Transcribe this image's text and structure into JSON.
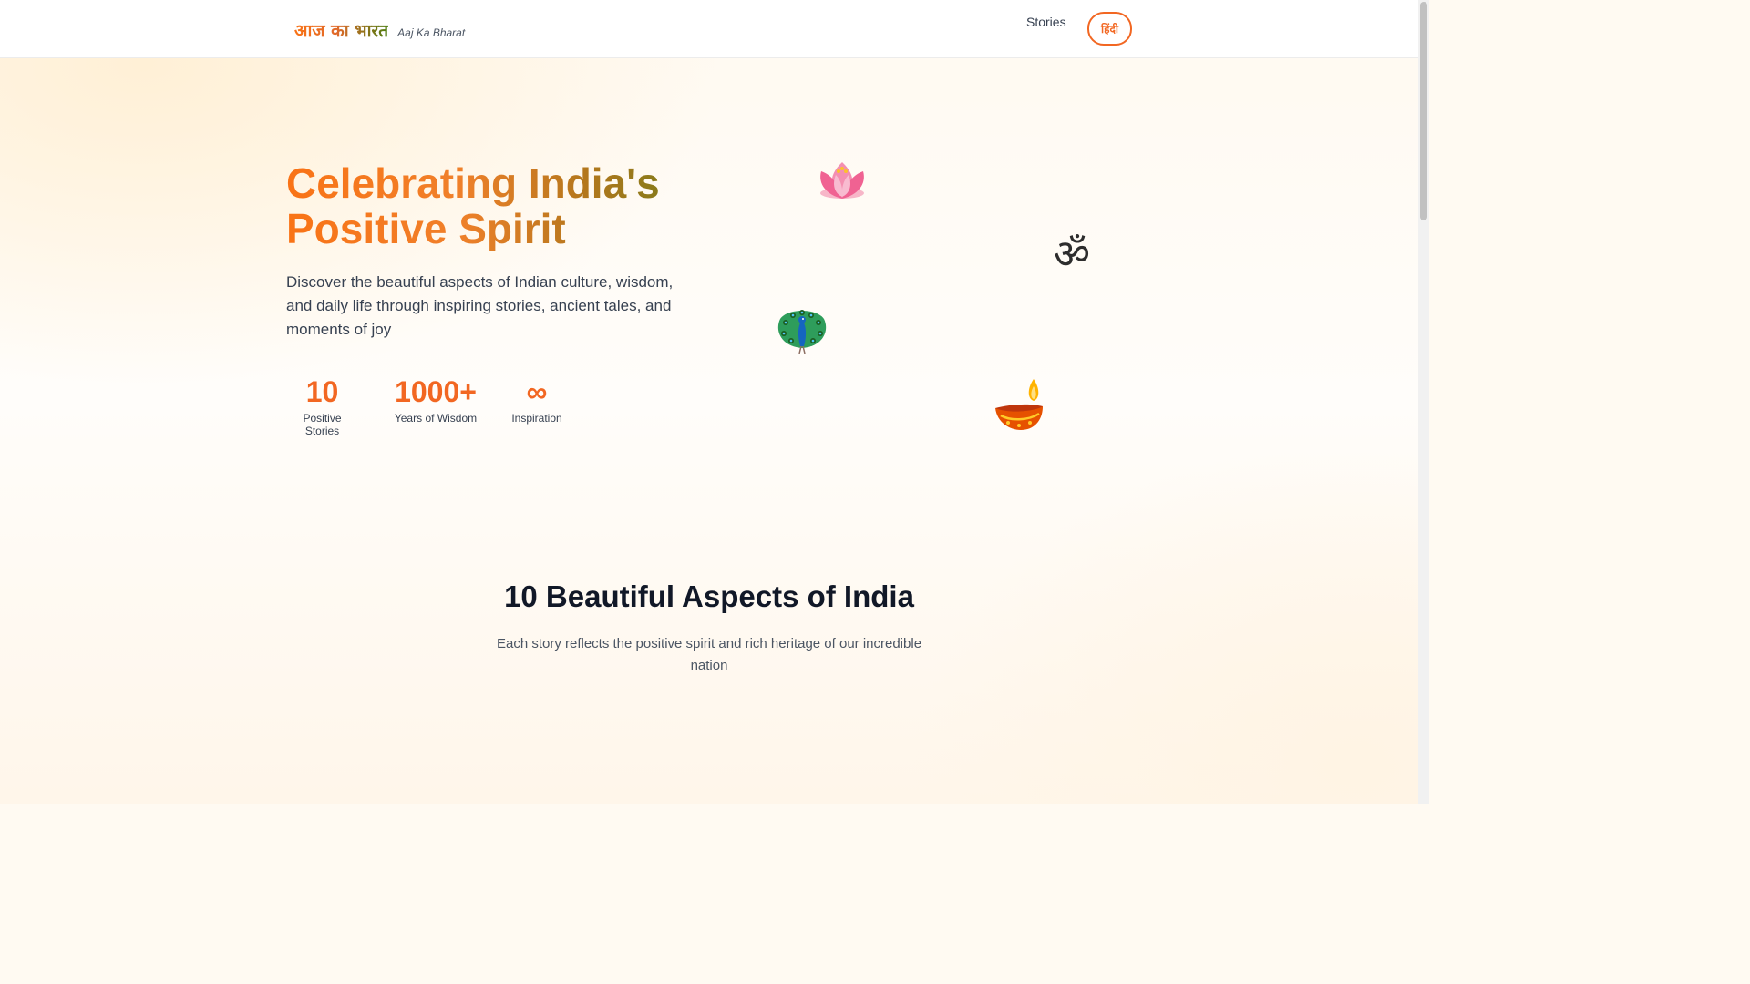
{
  "header": {
    "logo_hindi": "आज का भारत",
    "logo_sub": "Aaj Ka Bharat",
    "nav_stories": "Stories",
    "lang_toggle": "हिंदी"
  },
  "hero": {
    "title": "Celebrating India's Positive Spirit",
    "description": "Discover the beautiful aspects of Indian culture, wisdom, and daily life through inspiring stories, ancient tales, and moments of joy",
    "stats": [
      {
        "value": "10",
        "label": "Positive Stories"
      },
      {
        "value": "1000+",
        "label": "Years of Wisdom"
      },
      {
        "value": "∞",
        "label": "Inspiration"
      }
    ],
    "decor_icons": [
      "lotus-icon",
      "om-icon",
      "peacock-icon",
      "diya-icon"
    ]
  },
  "section": {
    "title": "10 Beautiful Aspects of India",
    "subtitle": "Each story reflects the positive spirit and rich heritage of our incredible nation"
  },
  "colors": {
    "accent": "#f26722",
    "green": "#4d7c0f"
  }
}
